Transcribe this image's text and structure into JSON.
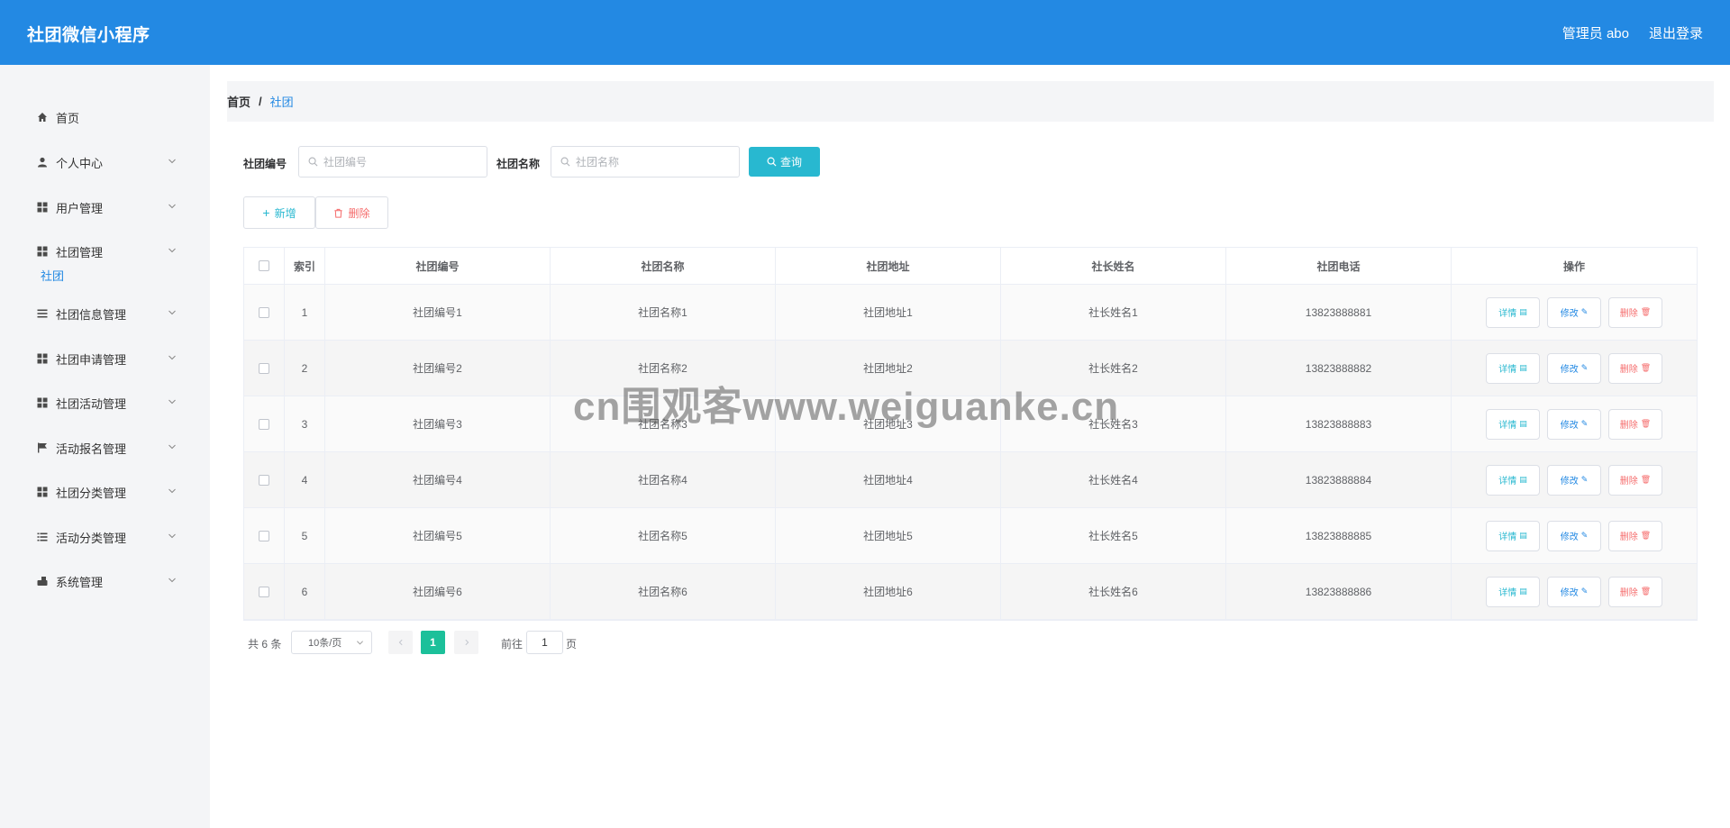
{
  "header": {
    "app_title": "社团微信小程序",
    "admin_label": "管理员 abo",
    "logout_label": "退出登录"
  },
  "sidebar": {
    "items": [
      {
        "label": "首页",
        "icon": "home-icon",
        "expandable": false
      },
      {
        "label": "个人中心",
        "icon": "user-icon",
        "expandable": true
      },
      {
        "label": "用户管理",
        "icon": "grid-icon",
        "expandable": true
      },
      {
        "label": "社团管理",
        "icon": "grid-icon",
        "expandable": true
      },
      {
        "label": "社团信息管理",
        "icon": "list-icon",
        "expandable": true
      },
      {
        "label": "社团申请管理",
        "icon": "grid-icon",
        "expandable": true
      },
      {
        "label": "社团活动管理",
        "icon": "grid-icon",
        "expandable": true
      },
      {
        "label": "活动报名管理",
        "icon": "flag-icon",
        "expandable": true
      },
      {
        "label": "社团分类管理",
        "icon": "grid-icon",
        "expandable": true
      },
      {
        "label": "活动分类管理",
        "icon": "list-icon",
        "expandable": true
      },
      {
        "label": "系统管理",
        "icon": "settings-icon",
        "expandable": true
      }
    ],
    "active_sub_item": "社团"
  },
  "breadcrumb": {
    "home": "首页",
    "separator": "/",
    "current": "社团"
  },
  "search": {
    "field1_label": "社团编号",
    "field1_placeholder": "社团编号",
    "field2_label": "社团名称",
    "field2_placeholder": "社团名称",
    "query_label": "查询"
  },
  "toolbar": {
    "add_label": "新增",
    "delete_label": "删除"
  },
  "table": {
    "headers": [
      "索引",
      "社团编号",
      "社团名称",
      "社团地址",
      "社长姓名",
      "社团电话",
      "操作"
    ],
    "rows": [
      [
        "1",
        "社团编号1",
        "社团名称1",
        "社团地址1",
        "社长姓名1",
        "13823888881"
      ],
      [
        "2",
        "社团编号2",
        "社团名称2",
        "社团地址2",
        "社长姓名2",
        "13823888882"
      ],
      [
        "3",
        "社团编号3",
        "社团名称3",
        "社团地址3",
        "社长姓名3",
        "13823888883"
      ],
      [
        "4",
        "社团编号4",
        "社团名称4",
        "社团地址4",
        "社长姓名4",
        "13823888884"
      ],
      [
        "5",
        "社团编号5",
        "社团名称5",
        "社团地址5",
        "社长姓名5",
        "13823888885"
      ],
      [
        "6",
        "社团编号6",
        "社团名称6",
        "社团地址6",
        "社长姓名6",
        "13823888886"
      ]
    ],
    "actions": {
      "detail": "详情",
      "edit": "修改",
      "delete": "删除"
    }
  },
  "pagination": {
    "total": "共 6 条",
    "page_size": "10条/页",
    "current_page": "1",
    "goto_label": "前往",
    "goto_value": "1",
    "page_suffix": "页"
  },
  "watermark": "cn围观客www.weiguanke.cn",
  "colors": {
    "header_bg": "#2389e3",
    "sidebar_bg": "#f4f5f7",
    "query_button": "#28b8d0",
    "active_page": "#1cc09a",
    "danger": "#f56c6c"
  }
}
